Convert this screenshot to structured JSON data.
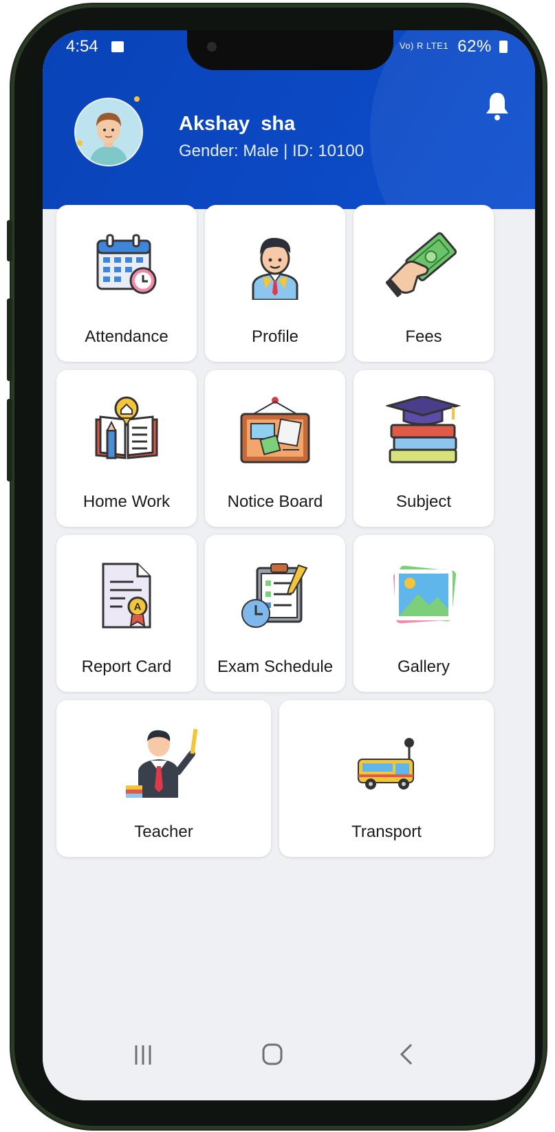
{
  "status_bar": {
    "time": "4:54",
    "signal_text": "Vo) R LTE1",
    "battery": "62%"
  },
  "profile": {
    "name": "Akshay  sha",
    "meta": "Gender: Male | ID: 10100"
  },
  "menu": [
    {
      "label": "Attendance",
      "icon": "calendar-clock-icon"
    },
    {
      "label": "Profile",
      "icon": "student-icon"
    },
    {
      "label": "Fees",
      "icon": "money-hand-icon"
    },
    {
      "label": "Home Work",
      "icon": "homework-book-icon"
    },
    {
      "label": "Notice Board",
      "icon": "notice-board-icon"
    },
    {
      "label": "Subject",
      "icon": "books-cap-icon"
    },
    {
      "label": "Report Card",
      "icon": "report-card-icon"
    },
    {
      "label": "Exam Schedule",
      "icon": "exam-schedule-icon"
    },
    {
      "label": "Gallery",
      "icon": "gallery-icon"
    },
    {
      "label": "Teacher",
      "icon": "teacher-icon"
    },
    {
      "label": "Transport",
      "icon": "school-bus-icon"
    }
  ],
  "nav": {
    "recent": "recent-apps-icon",
    "home": "home-icon",
    "back": "back-icon"
  },
  "colors": {
    "header": "#0a43b8",
    "background": "#eef0f3",
    "card": "#ffffff"
  }
}
